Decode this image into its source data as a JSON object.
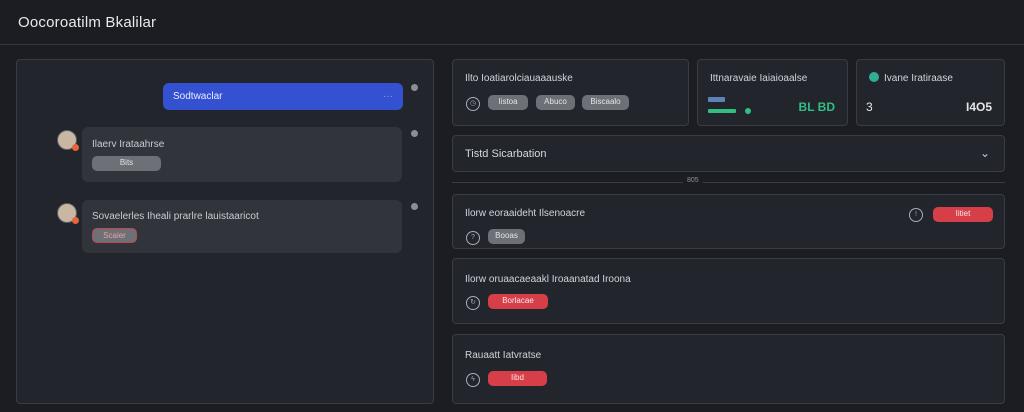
{
  "app": {
    "title": "Oocoroatilm Bkalilar"
  },
  "chat": {
    "user_message": "Sodtwaclar",
    "user_dots": "···",
    "bot1": {
      "text": "Ilaerv Irataahrse",
      "button": "Bits"
    },
    "bot2": {
      "text": "Sovaelerles Iheali prarlre lauistaaricot",
      "button": "Scaier"
    }
  },
  "cards": [
    {
      "title": "Ilto Ioatiarolciauaaauske",
      "pills": [
        "Iistoa",
        "Abuco",
        "Biscaalo"
      ]
    },
    {
      "title": "Ittnaravaie Iaiaioaalse",
      "value": "BL BD"
    },
    {
      "title": "Ivane Iratiraase",
      "left": "3",
      "value": "I4O5"
    }
  ],
  "select": {
    "label": "Tistd Sicarbation"
  },
  "divider": {
    "label": "805"
  },
  "rows": [
    {
      "title": "Ilorw eoraaideht Ilsenoacre",
      "button": "Booas",
      "action": "Iitiet"
    },
    {
      "title": "Ilorw oruaacaeaakl Iroaanatad Iroona",
      "action": "Borlacae"
    },
    {
      "title": "Rauaatt Iatvratse",
      "action": "Iibd"
    }
  ],
  "colors": {
    "accent_blue": "#3451d1",
    "danger": "#d63e48",
    "success": "#2fbf83"
  }
}
